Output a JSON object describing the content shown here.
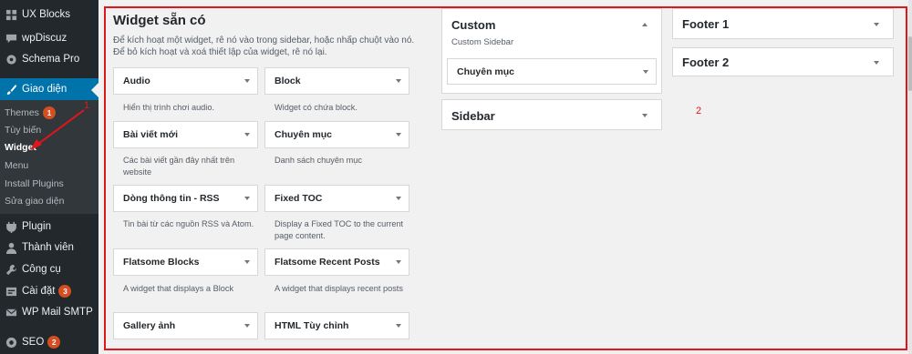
{
  "sidebar": {
    "menu": [
      {
        "label": "UX Blocks",
        "icon": "grid-icon",
        "badge": null
      },
      {
        "label": "wpDiscuz",
        "icon": "comment-icon",
        "badge": null
      },
      {
        "label": "Schema Pro",
        "icon": "gear-icon",
        "badge": null
      },
      {
        "label": "Giao diện",
        "icon": "paintbrush-icon",
        "badge": null
      },
      {
        "label": "Plugin",
        "icon": "plug-icon",
        "badge": null
      },
      {
        "label": "Thành viên",
        "icon": "user-icon",
        "badge": null
      },
      {
        "label": "Công cụ",
        "icon": "wrench-icon",
        "badge": null
      },
      {
        "label": "Cài đặt",
        "icon": "settings-icon",
        "badge": "3"
      },
      {
        "label": "WP Mail SMTP",
        "icon": "mail-icon",
        "badge": null
      },
      {
        "label": "SEO",
        "icon": "seo-icon",
        "badge": "2"
      }
    ],
    "submenu": [
      {
        "label": "Themes",
        "badge": "1"
      },
      {
        "label": "Tùy biến",
        "badge": null
      },
      {
        "label": "Widget",
        "badge": null
      },
      {
        "label": "Menu",
        "badge": null
      },
      {
        "label": "Install Plugins",
        "badge": null
      },
      {
        "label": "Sửa giao diện",
        "badge": null
      }
    ]
  },
  "annotations": {
    "one": "1",
    "two": "2"
  },
  "available": {
    "title": "Widget sẵn có",
    "desc1": "Để kích hoạt một widget, rê nó vào trong sidebar, hoặc nhấp chuột vào nó.",
    "desc2": "Để bỏ kích hoạt và xoá thiết lập của widget, rê nó lại.",
    "widgets": [
      {
        "title": "Audio",
        "desc": "Hiển thị trình chơi audio."
      },
      {
        "title": "Block",
        "desc": "Widget có chứa block."
      },
      {
        "title": "Bài viết mới",
        "desc": "Các bài viết gần đây nhất trên website"
      },
      {
        "title": "Chuyên mục",
        "desc": "Danh sách chuyên mục"
      },
      {
        "title": "Dòng thông tin - RSS",
        "desc": "Tin bài từ các nguồn RSS và Atom."
      },
      {
        "title": "Fixed TOC",
        "desc": "Display a Fixed TOC to the current page content."
      },
      {
        "title": "Flatsome Blocks",
        "desc": "A widget that displays a Block"
      },
      {
        "title": "Flatsome Recent Posts",
        "desc": "A widget that displays recent posts"
      },
      {
        "title": "Gallery ảnh",
        "desc": ""
      },
      {
        "title": "HTML Tùy chỉnh",
        "desc": ""
      }
    ]
  },
  "sidebars": {
    "custom": {
      "title": "Custom",
      "desc": "Custom Sidebar",
      "widget": "Chuyên mục"
    },
    "sidebar": {
      "title": "Sidebar"
    },
    "footer1": {
      "title": "Footer 1"
    },
    "footer2": {
      "title": "Footer 2"
    }
  },
  "colors": {
    "accent": "#0073aa",
    "annotation": "#e0161b",
    "badge": "#d54e21"
  }
}
